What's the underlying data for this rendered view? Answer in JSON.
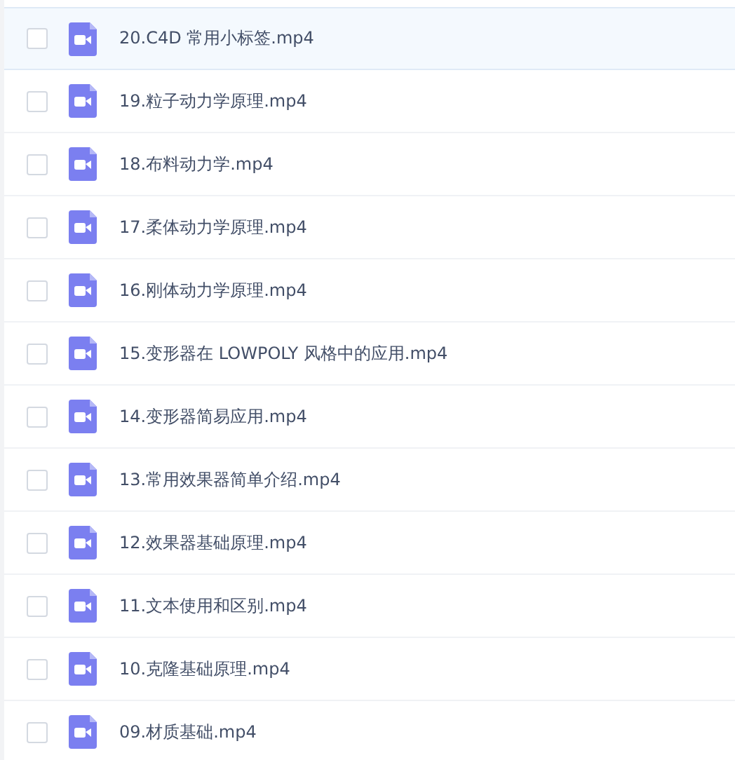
{
  "files": [
    {
      "name": "20.C4D 常用小标签.mp4",
      "checked": false,
      "highlighted": true
    },
    {
      "name": "19.粒子动力学原理.mp4",
      "checked": false,
      "highlighted": false
    },
    {
      "name": "18.布料动力学.mp4",
      "checked": false,
      "highlighted": false
    },
    {
      "name": "17.柔体动力学原理.mp4",
      "checked": false,
      "highlighted": false
    },
    {
      "name": "16.刚体动力学原理.mp4",
      "checked": false,
      "highlighted": false
    },
    {
      "name": "15.变形器在 LOWPOLY 风格中的应用.mp4",
      "checked": false,
      "highlighted": false
    },
    {
      "name": "14.变形器简易应用.mp4",
      "checked": false,
      "highlighted": false
    },
    {
      "name": "13.常用效果器简单介绍.mp4",
      "checked": false,
      "highlighted": false
    },
    {
      "name": "12.效果器基础原理.mp4",
      "checked": false,
      "highlighted": false
    },
    {
      "name": "11.文本使用和区别.mp4",
      "checked": false,
      "highlighted": false
    },
    {
      "name": "10.克隆基础原理.mp4",
      "checked": false,
      "highlighted": false
    },
    {
      "name": "09.材质基础.mp4",
      "checked": false,
      "highlighted": false
    }
  ]
}
